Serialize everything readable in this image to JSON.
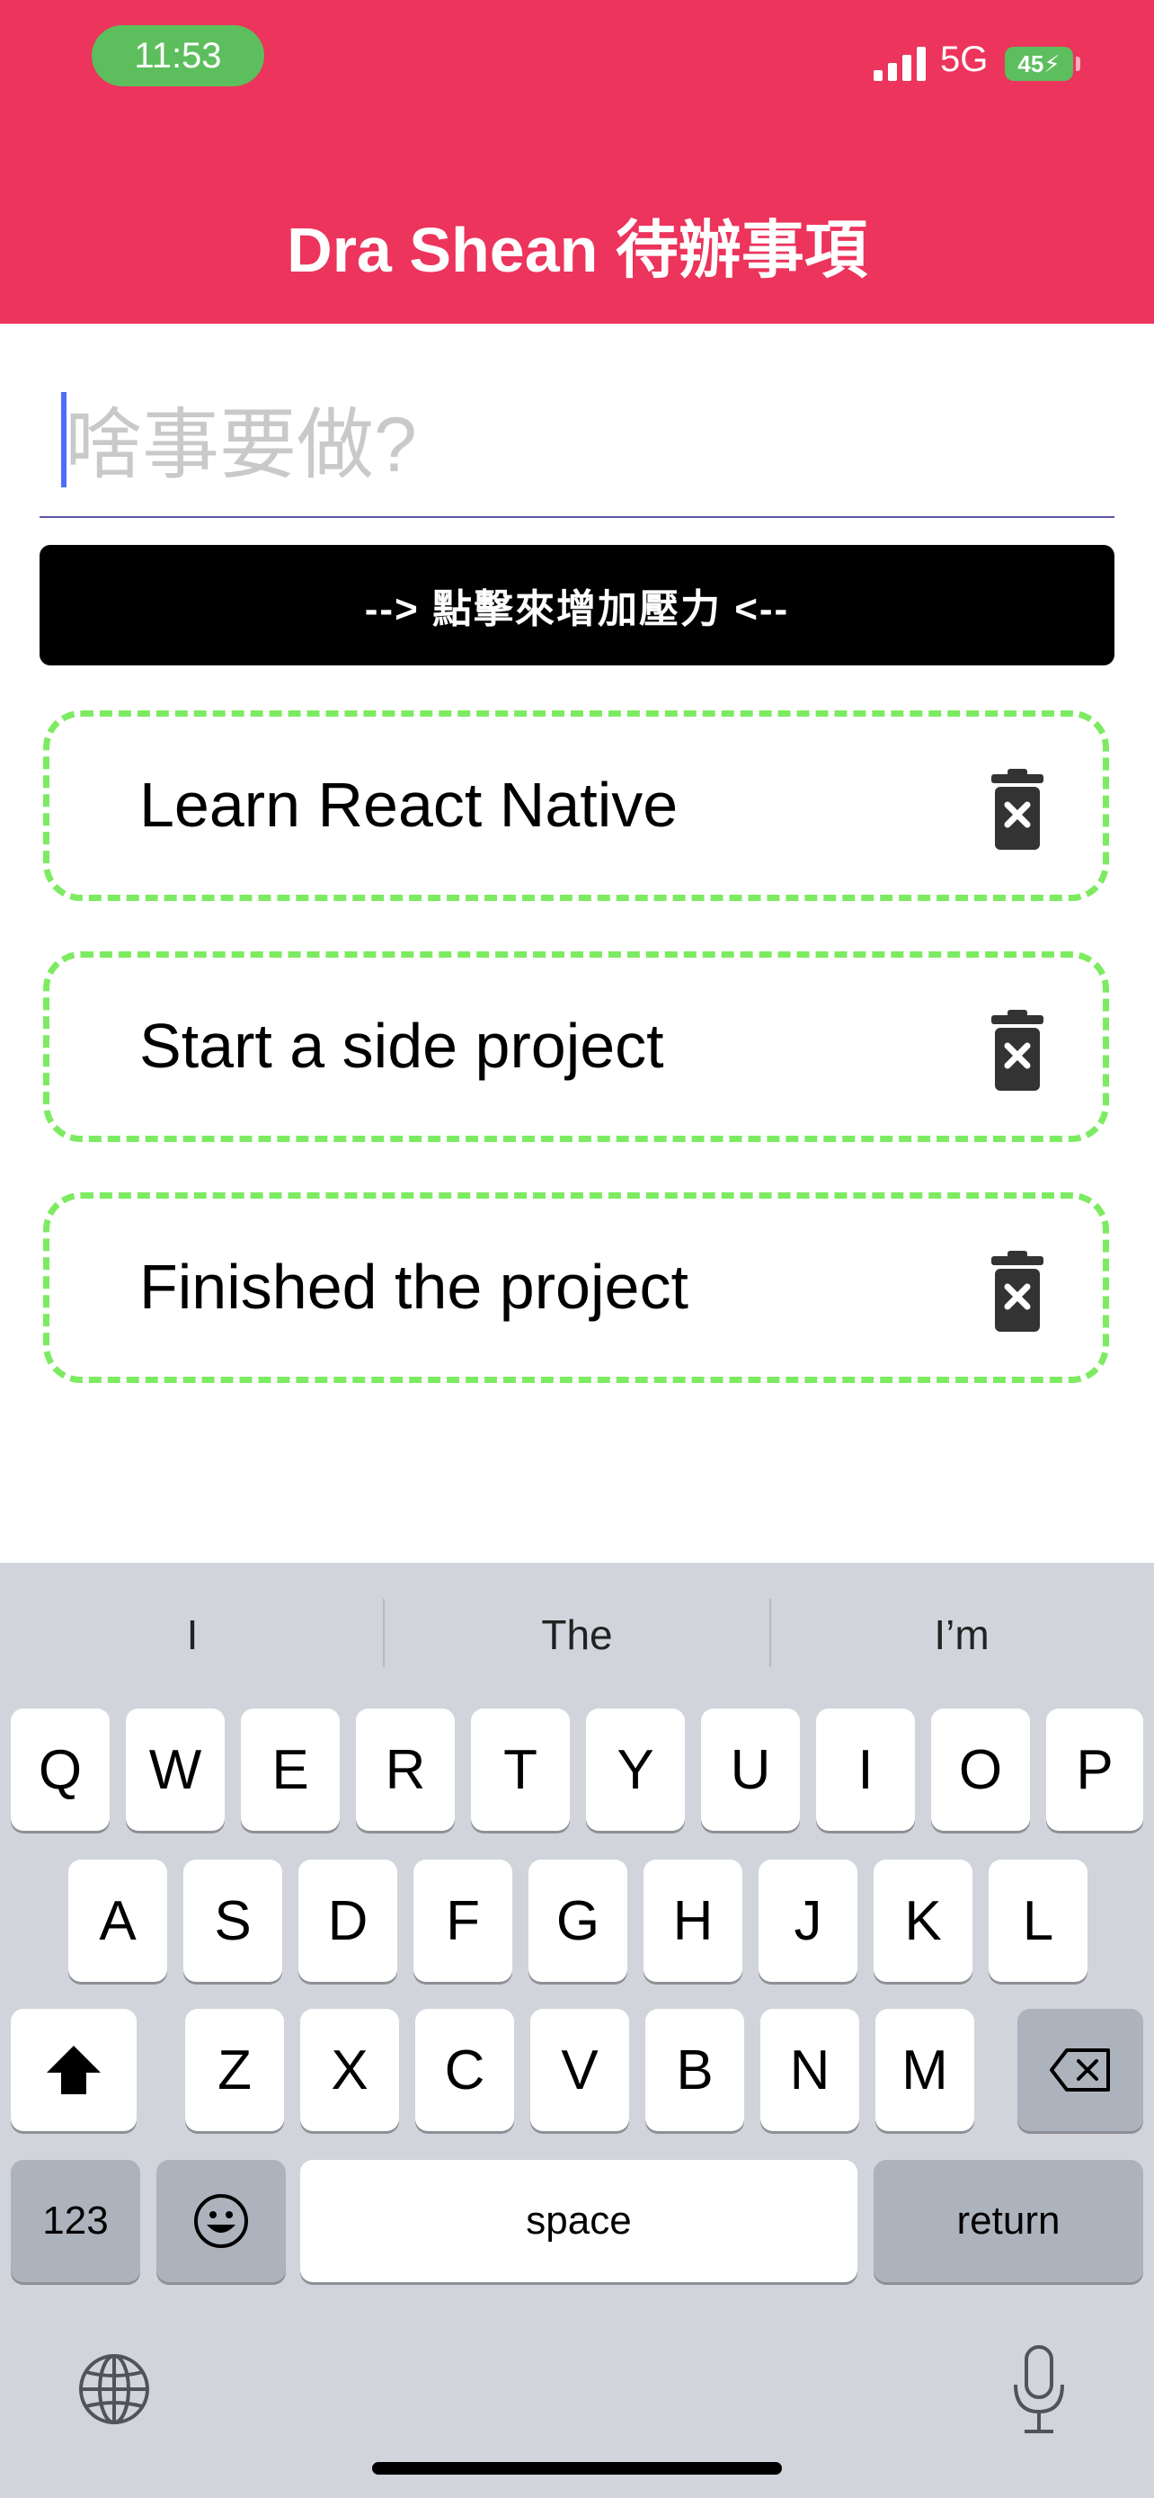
{
  "status_bar": {
    "time": "11:53",
    "network": "5G",
    "battery": "45"
  },
  "header": {
    "title": "Dra Shean 待辦事項"
  },
  "input": {
    "placeholder": "啥事要做?",
    "value": ""
  },
  "add_button": {
    "label": "--> 點擊來增加壓力 <--"
  },
  "todos": [
    {
      "text": "Learn React Native"
    },
    {
      "text": "Start a side project"
    },
    {
      "text": "Finished the project"
    }
  ],
  "keyboard": {
    "suggestions": [
      "I",
      "The",
      "I’m"
    ],
    "row1": [
      "Q",
      "W",
      "E",
      "R",
      "T",
      "Y",
      "U",
      "I",
      "O",
      "P"
    ],
    "row2": [
      "A",
      "S",
      "D",
      "F",
      "G",
      "H",
      "J",
      "K",
      "L"
    ],
    "row3": [
      "Z",
      "X",
      "C",
      "V",
      "B",
      "N",
      "M"
    ],
    "numbers_label": "123",
    "space_label": "space",
    "return_label": "return"
  },
  "colors": {
    "header": "#EC345C",
    "todo_border": "#7DEB62",
    "time_pill": "#5DBE5E"
  },
  "icons": [
    "signal-icon",
    "battery-icon",
    "trash-icon",
    "shift-icon",
    "backspace-icon",
    "emoji-icon",
    "globe-icon",
    "microphone-icon"
  ]
}
